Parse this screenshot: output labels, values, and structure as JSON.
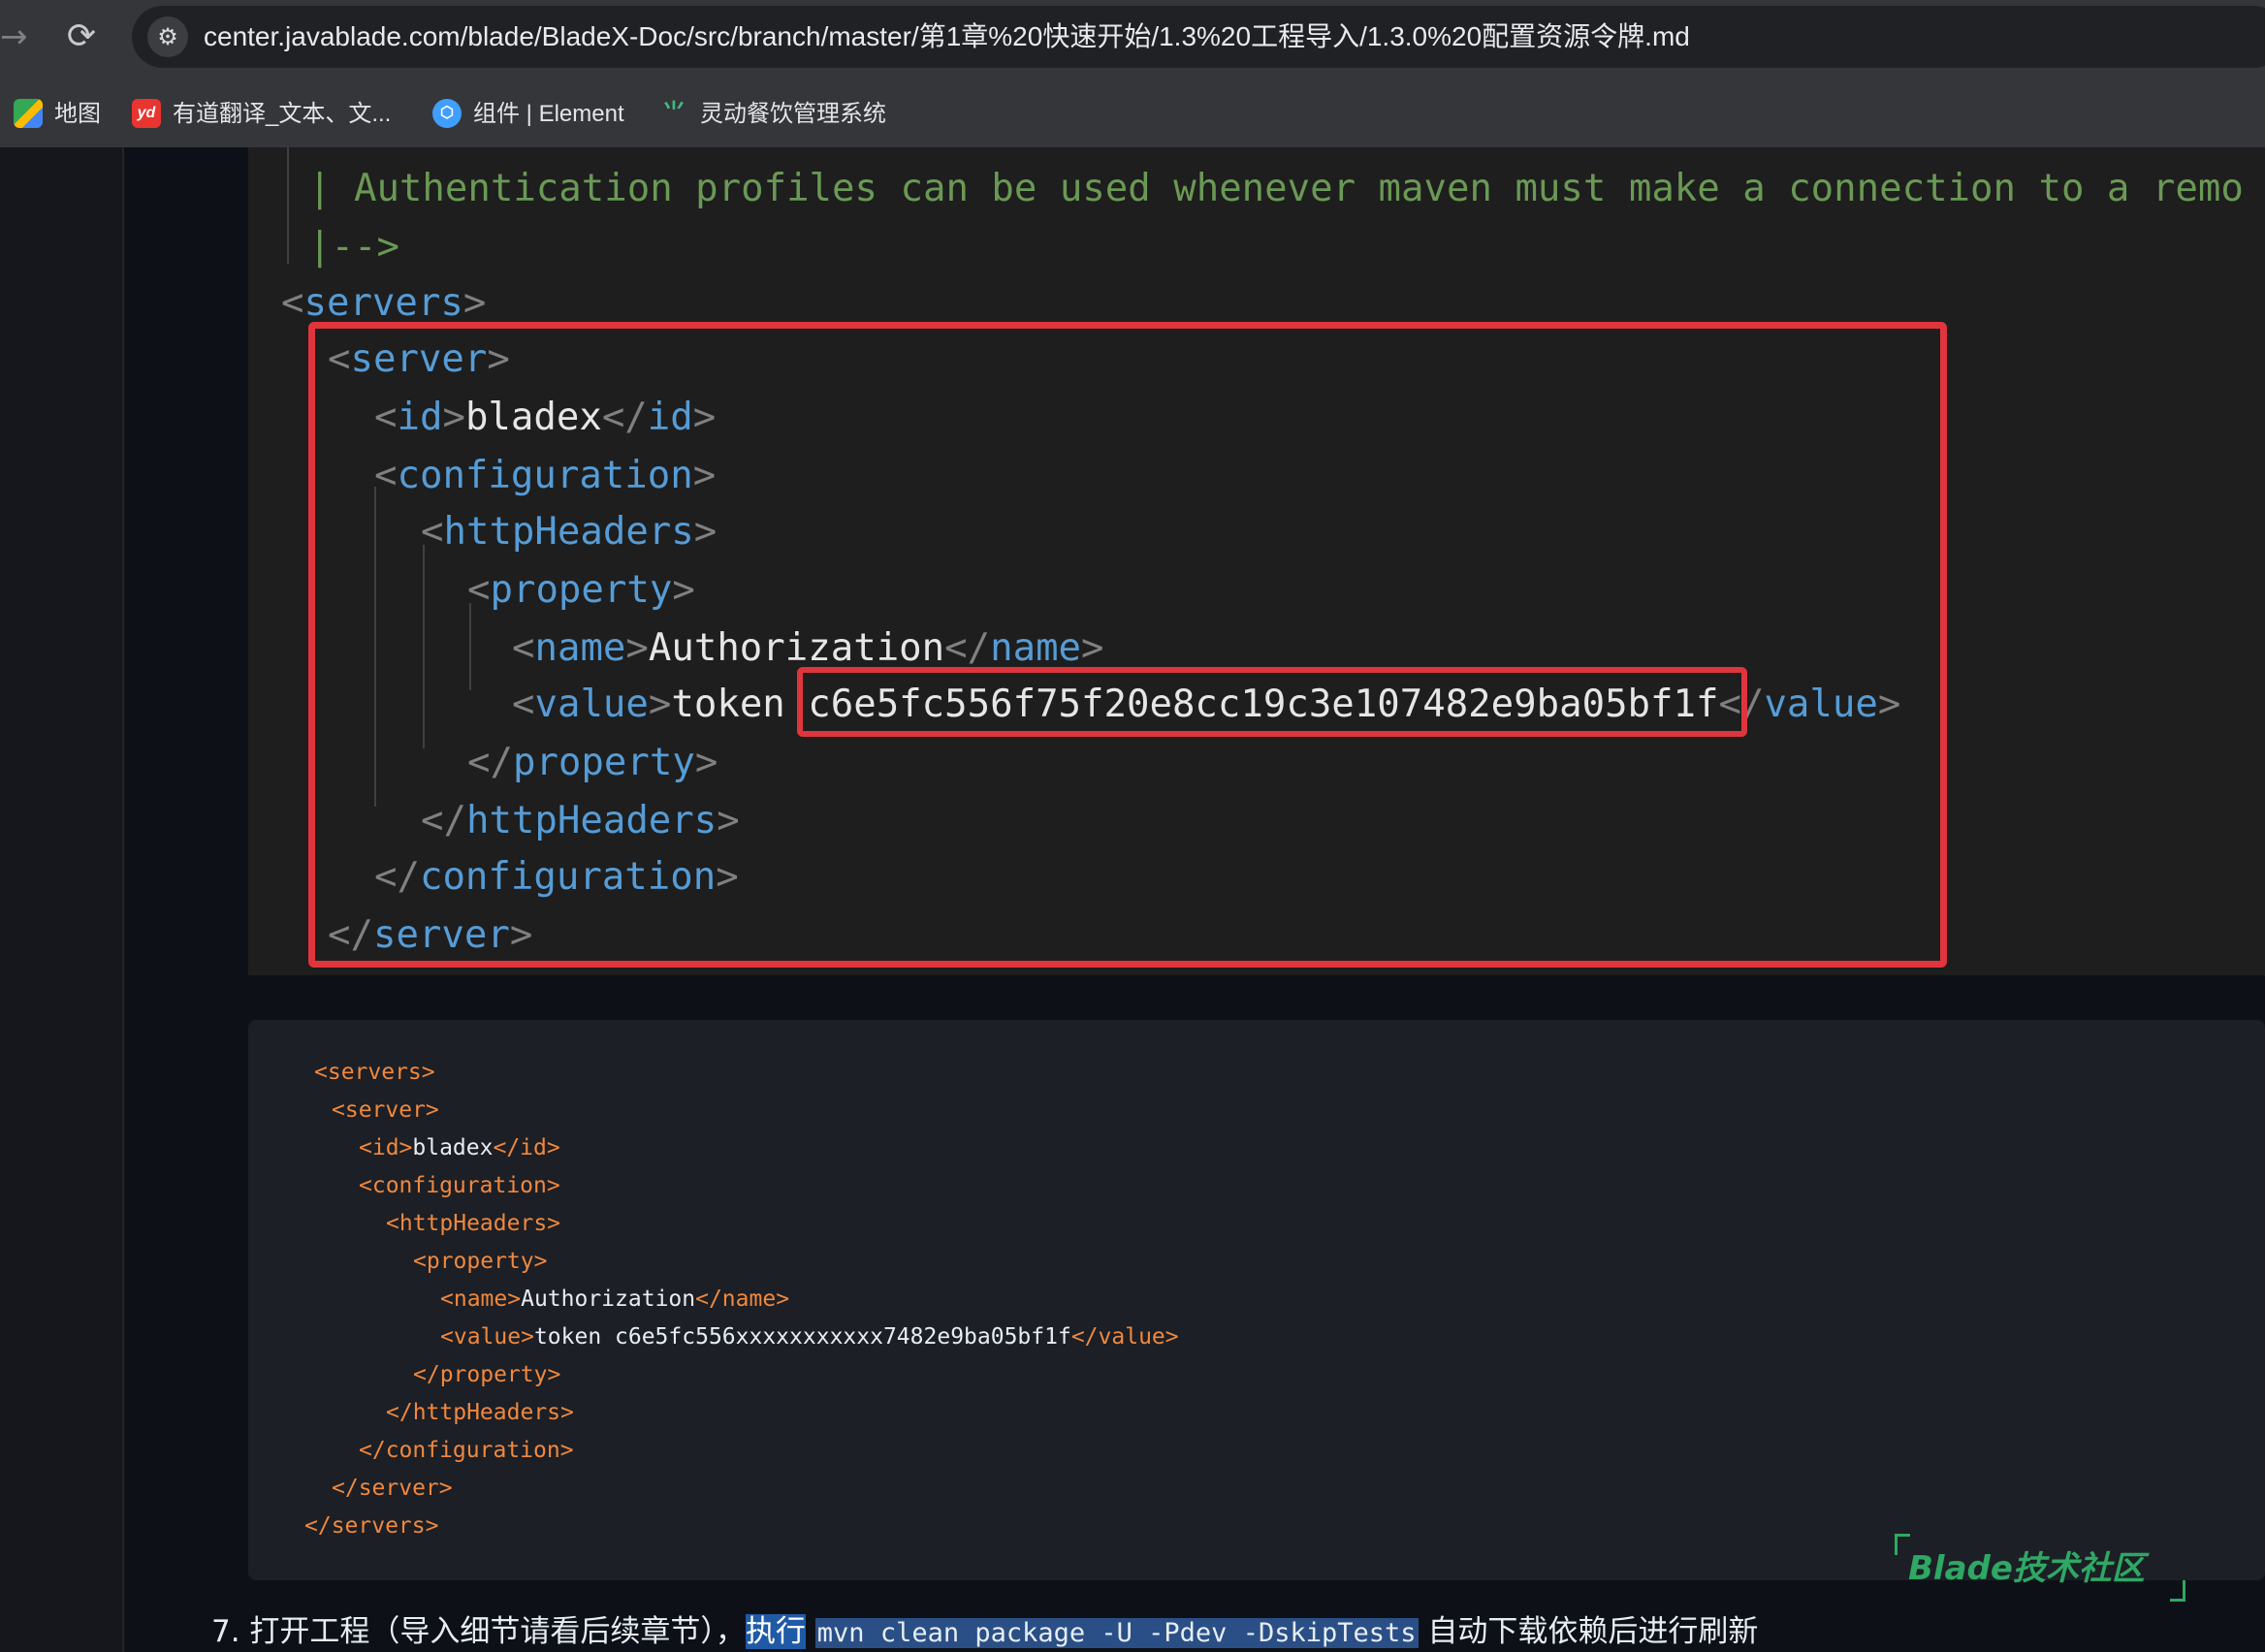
{
  "browser": {
    "url": "center.javablade.com/blade/BladeX-Doc/src/branch/master/第1章%20快速开始/1.3%20工程导入/1.3.0%20配置资源令牌.md",
    "bookmarks": [
      {
        "label": "地图",
        "icon": "maps-icon"
      },
      {
        "label": "有道翻译_文本、文...",
        "icon": "youdao-icon",
        "icon_text": "yd"
      },
      {
        "label": "组件 | Element",
        "icon": "element-icon",
        "icon_text": "⬡"
      },
      {
        "label": "灵动餐饮管理系统",
        "icon": "vue-leaf-icon",
        "icon_text": "⺌"
      }
    ]
  },
  "editor_image": {
    "comment_line": "| Authentication profiles can be used whenever maven must make a connection to a remo",
    "comment_end": "|-->",
    "tags": {
      "servers_open": "servers",
      "server_open": "server",
      "id": "id",
      "configuration": "configuration",
      "httpHeaders": "httpHeaders",
      "property": "property",
      "name": "name",
      "value": "value",
      "server_close": "server"
    },
    "id_value": "bladex",
    "name_value": "Authorization",
    "token_prefix": "token ",
    "token_value": "c6e5fc556f75f20e8cc19c3e107482e9ba05bf1f"
  },
  "code_block": {
    "lines": [
      {
        "open": "<servers>",
        "text": "",
        "close": ""
      },
      {
        "open": "<server>",
        "text": "",
        "close": ""
      },
      {
        "open": "<id>",
        "text": "bladex",
        "close": "</id>"
      },
      {
        "open": "<configuration>",
        "text": "",
        "close": ""
      },
      {
        "open": "<httpHeaders>",
        "text": "",
        "close": ""
      },
      {
        "open": "<property>",
        "text": "",
        "close": ""
      },
      {
        "open": "<name>",
        "text": "Authorization",
        "close": "</name>"
      },
      {
        "open": "<value>",
        "text": "token c6e5fc556xxxxxxxxxxx7482e9ba05bf1f",
        "close": "</value>"
      },
      {
        "open": "</property>",
        "text": "",
        "close": ""
      },
      {
        "open": "</httpHeaders>",
        "text": "",
        "close": ""
      },
      {
        "open": "</configuration>",
        "text": "",
        "close": ""
      },
      {
        "open": "</server>",
        "text": "",
        "close": ""
      },
      {
        "open": "</servers>",
        "text": "",
        "close": ""
      }
    ]
  },
  "watermark": "Blade技术社区",
  "step7": {
    "prefix": "7. 打开工程（导入细节请看后续章节），",
    "highlight": "执行",
    "command": "mvn clean package -U -Pdev -DskipTests",
    "suffix": " 自动下载依赖后进行刷新"
  },
  "colors": {
    "highlight_box": "#e0353d",
    "xml_tag_editor": "#569cd6",
    "xml_tag_block": "#f0883e",
    "comment": "#6a9955",
    "watermark": "#2ea864"
  }
}
